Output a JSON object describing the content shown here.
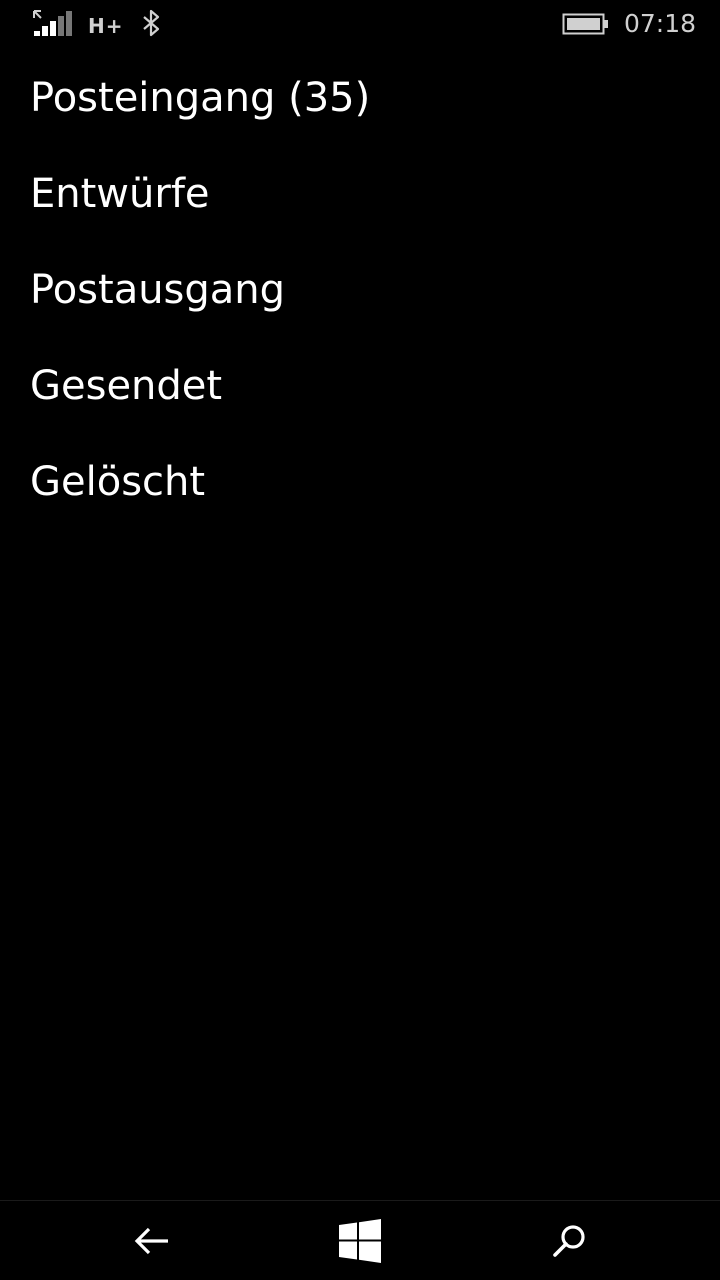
{
  "status_bar": {
    "network_type": "H+",
    "time": "07:18",
    "icons": [
      "signal-icon",
      "bluetooth-icon",
      "battery-icon"
    ]
  },
  "folders": [
    {
      "label": "Posteingang (35)"
    },
    {
      "label": "Entwürfe"
    },
    {
      "label": "Postausgang"
    },
    {
      "label": "Gesendet"
    },
    {
      "label": "Gelöscht"
    }
  ],
  "nav_bar": {
    "icons": [
      "back-arrow-icon",
      "windows-start-icon",
      "search-icon"
    ]
  },
  "colors": {
    "background": "#000000",
    "text": "#ffffff",
    "status_text": "#d0d0d0"
  }
}
